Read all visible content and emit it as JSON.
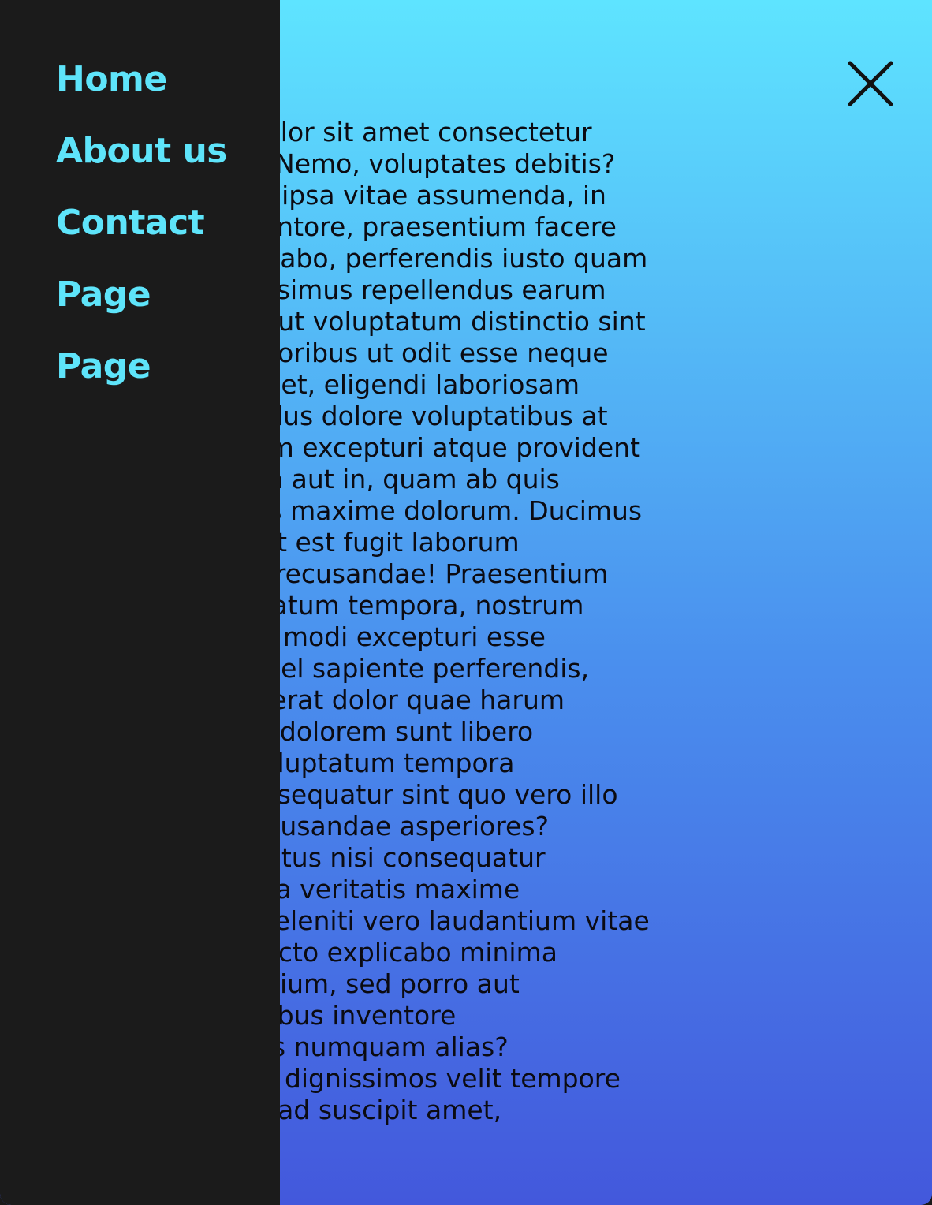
{
  "nav": {
    "items": [
      {
        "label": "Home"
      },
      {
        "label": "About us"
      },
      {
        "label": "Contact"
      },
      {
        "label": "Page"
      },
      {
        "label": "Page"
      }
    ]
  },
  "close_icon": "close-icon",
  "content": {
    "lines": [
      "Lorem ipsum dolor sit amet consectetur",
      "adipisicing elit. Nemo, voluptates debitis?",
      "Dolores dolores ipsa vitae assumenda, in",
      "fugit facilis inventore, praesentium facere",
      "explicabo explicabo, perferendis iusto quam",
      "recusandae possimus repellendus earum",
      "laborum dolor aut voluptatum distinctio sint",
      "placeat, sed doloribus ut odit esse neque",
      "sapiente facere et, eligendi laboriosam",
      "labore repellendus dolore voluptatibus at",
      "quae voluptatum excepturi atque provident",
      "nihil voluptatem aut in, quam ab quis",
      "quisquam facilis maxime dolorum. Ducimus",
      "aliquid quos odit est fugit laborum",
      "dolorum soluta recusandae! Praesentium",
      "tempora voluptatum tempora, nostrum",
      "sunt non magni modi excepturi esse",
      "laborum nobis vel sapiente perferendis,",
      "quisquam! Quaerat dolor quae harum",
      "facere nesciunt dolorem sunt libero",
      "ipsum ipsum voluptatum tempora",
      "recusandae consequatur sint quo vero illo",
      "nobis, quam recusandae asperiores?",
      "Quisquam delectus nisi consequatur",
      "doloremque quia veritatis maxime",
      "reprehenderit deleniti vero laudantium vitae",
      "nostrum architecto explicabo minima",
      "officiis accusantium, sed porro aut",
      "placeat temporibus inventore",
      "facere reiciendis numquam alias?",
      "Perspiciatis iure dignissimos velit tempore",
      "excepti aut nisi ad suscipit amet,"
    ]
  },
  "colors": {
    "drawer_background": "#1b1b1b",
    "nav_link": "#5ee4fa",
    "gradient_top": "#5ee4ff",
    "gradient_bottom": "#4358dc",
    "text": "#0b0b12"
  }
}
